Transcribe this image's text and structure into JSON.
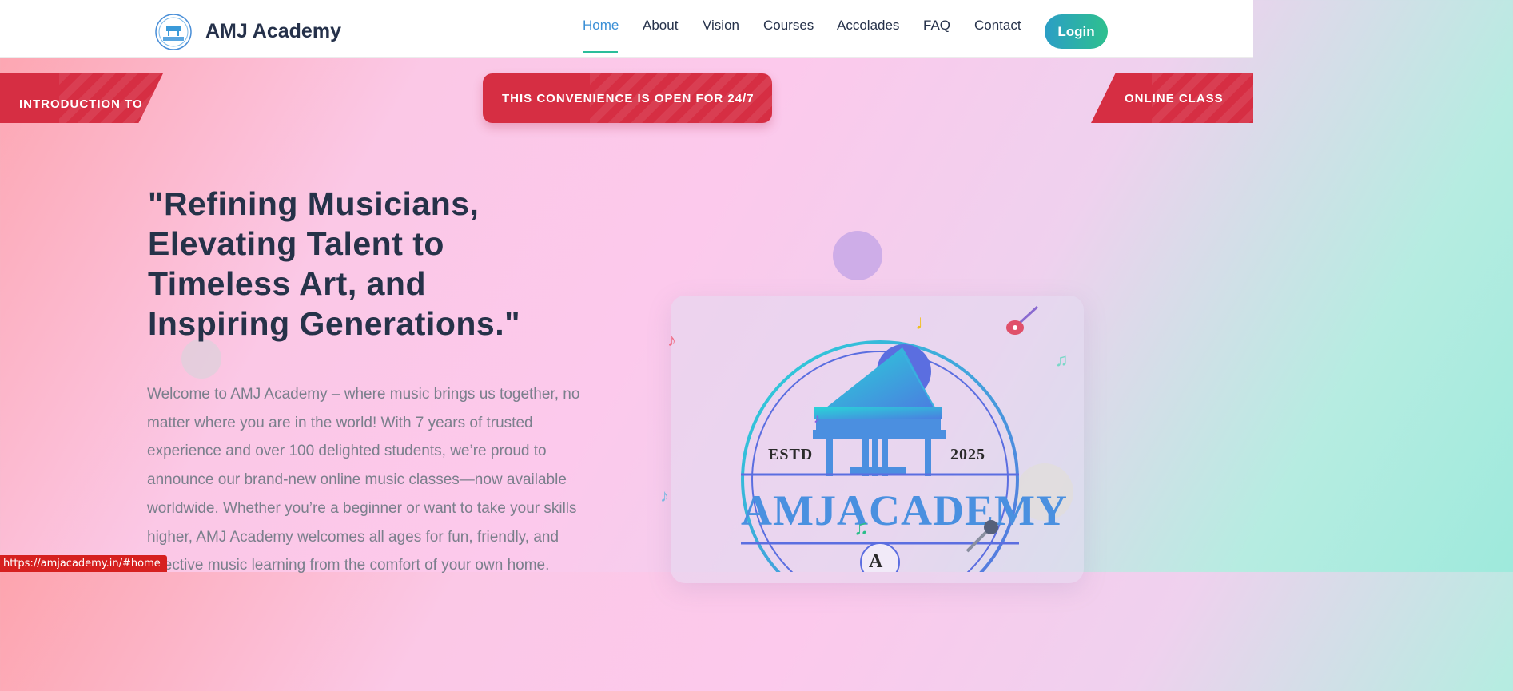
{
  "header": {
    "brand": "AMJ Academy",
    "nav": [
      {
        "label": "Home",
        "active": true
      },
      {
        "label": "About"
      },
      {
        "label": "Vision"
      },
      {
        "label": "Courses"
      },
      {
        "label": "Accolades"
      },
      {
        "label": "FAQ"
      },
      {
        "label": "Contact"
      }
    ],
    "login_label": "Login"
  },
  "ribbons": {
    "left": "INTRODUCTION TO",
    "center": "THIS CONVENIENCE IS OPEN FOR 24/7",
    "right": "ONLINE CLASS"
  },
  "hero": {
    "title_lines": [
      "\"Refining Musicians,",
      "Elevating Talent to",
      "Timeless Art, and",
      "Inspiring Generations.\""
    ],
    "text": "Welcome to AMJ Academy – where music brings us together, no matter where you are in the world! With 7 years of trusted experience and over 100 delighted students, we’re proud to announce our brand-new online music classes—now available worldwide. Whether you’re a beginner or want to take your skills higher, AMJ Academy welcomes all ages for fun, friendly, and effective music learning from the comfort of your own home."
  },
  "card": {
    "estd_label": "ESTD",
    "year": "2025",
    "academy_name": "AMJACADEMY",
    "monogram": "A"
  },
  "status_url": "https://amjacademy.in/#home",
  "colors": {
    "accent": "#3a8fd6",
    "ribbon": "#d62e43",
    "title": "#263249"
  }
}
